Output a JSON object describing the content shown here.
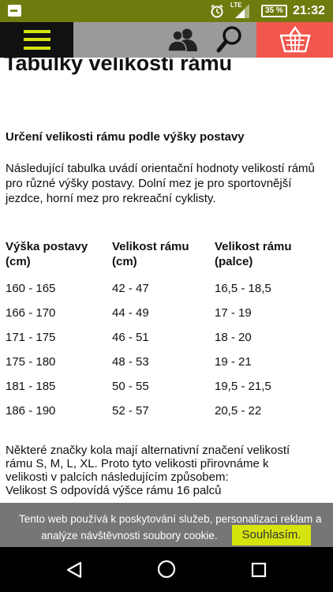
{
  "status_bar": {
    "network": "LTE",
    "battery": "35 %",
    "time": "21:32"
  },
  "header": {
    "menu_icon": "hamburger-icon",
    "user_icon": "users-icon",
    "search_icon": "search-icon",
    "cart_icon": "basket-icon",
    "accent_color": "#d6e40e",
    "cart_color": "#f2564c"
  },
  "page": {
    "title": "Tabulky velikostí rámu",
    "section_title": "Určení velikosti rámu podle výšky postavy",
    "intro": "Následující tabulka uvádí orientační hodnoty velikostí rámů pro různé výšky postavy. Dolní mez je pro sportovnější jezdce, horní mez pro rekreační cyklisty.",
    "table": {
      "headers": [
        "Výška postavy (cm)",
        "Velikost rámu (cm)",
        "Velikost rámu (palce)"
      ],
      "rows": [
        [
          "160 - 165",
          "42 - 47",
          "16,5 - 18,5"
        ],
        [
          "166 - 170",
          "44 - 49",
          "17 - 19"
        ],
        [
          "171 - 175",
          "46 - 51",
          "18 - 20"
        ],
        [
          "175 - 180",
          "48 - 53",
          "19 - 21"
        ],
        [
          "181 - 185",
          "50 - 55",
          "19,5 - 21,5"
        ],
        [
          "186 - 190",
          "52 - 57",
          "20,5 - 22"
        ]
      ]
    },
    "note_lines": [
      "Některé značky kola mají alternativní značení velikostí",
      "rámu S, M, L, XL. Proto tyto velikosti přirovnáme k",
      "velikosti v palcích následujícím způsobem:",
      "Velikost S odpovídá výšce rámu 16 palců"
    ]
  },
  "cookie": {
    "line1": "Tento web používá k poskytování služeb, personalizaci reklam a",
    "line2": "analýze návštěvnosti soubory cookie.",
    "button": "Souhlasím."
  },
  "nav": {
    "back_icon": "back-triangle-icon",
    "home_icon": "home-circle-icon",
    "recent_icon": "recent-apps-icon"
  }
}
